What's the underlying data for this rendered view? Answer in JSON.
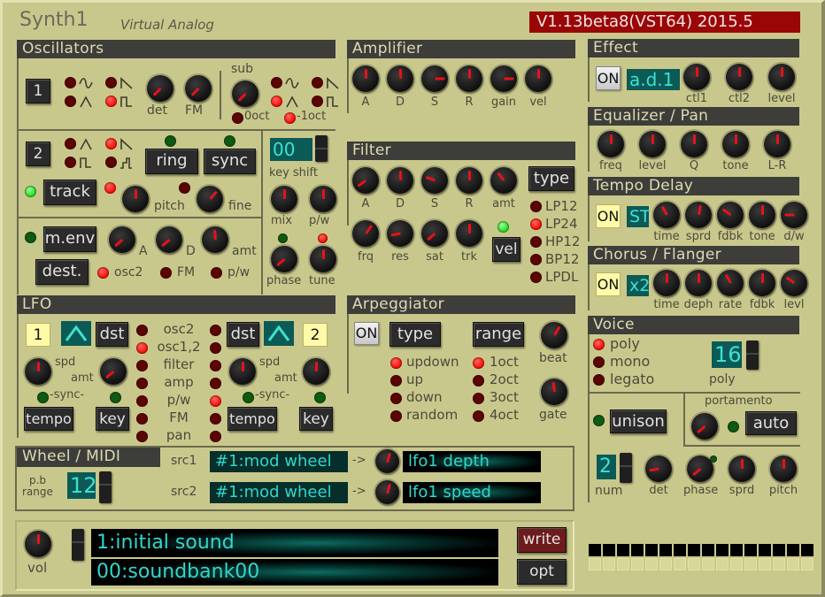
{
  "app": {
    "title": "Synth1",
    "subtitle": "Virtual Analog",
    "version": "V1.13beta8(VST64) 2015.5"
  },
  "oscillators": {
    "header": "Oscillators",
    "osc1_button": "1",
    "osc1_waves": [
      {
        "shape": "sine",
        "on": false
      },
      {
        "shape": "saw",
        "on": false
      },
      {
        "shape": "triangle",
        "on": false
      },
      {
        "shape": "square",
        "on": true
      }
    ],
    "det_label": "det",
    "fm_label": "FM",
    "sub_label": "sub",
    "sub_waves": [
      {
        "shape": "sine",
        "on": false
      },
      {
        "shape": "saw",
        "on": false
      },
      {
        "shape": "triangle",
        "on": true
      },
      {
        "shape": "square",
        "on": false
      }
    ],
    "sub_oct": [
      {
        "label": "0oct",
        "on": false
      },
      {
        "label": "-1oct",
        "on": true
      }
    ],
    "osc2_button": "2",
    "osc2_waves": [
      {
        "shape": "triangle",
        "on": false
      },
      {
        "shape": "saw",
        "on": true
      },
      {
        "shape": "square",
        "on": false
      },
      {
        "shape": "noise-pulse",
        "on": false
      }
    ],
    "ring_label": "ring",
    "sync_label": "sync",
    "track_label": "track",
    "pitch_label": "pitch",
    "fine_label": "fine",
    "keyshift_value": "00",
    "keyshift_label": "key shift",
    "mix_label": "mix",
    "pw_label": "p/w",
    "phase_label": "phase",
    "tune_label": "tune",
    "menv_label": "m.env",
    "a_label": "A",
    "d_label": "D",
    "amt_label": "amt",
    "dest_label": "dest.",
    "dest_options": [
      {
        "label": "osc2",
        "on": true
      },
      {
        "label": "FM",
        "on": false
      },
      {
        "label": "p/w",
        "on": false
      }
    ]
  },
  "amplifier": {
    "header": "Amplifier",
    "knobs": [
      "A",
      "D",
      "S",
      "R",
      "gain",
      "vel"
    ]
  },
  "filter": {
    "header": "Filter",
    "knobs_top": [
      "A",
      "D",
      "S",
      "R",
      "amt"
    ],
    "knobs_bottom": [
      "frq",
      "res",
      "sat",
      "trk"
    ],
    "type_label": "type",
    "vel_label": "vel",
    "types": [
      {
        "label": "LP12",
        "on": false
      },
      {
        "label": "LP24",
        "on": true
      },
      {
        "label": "HP12",
        "on": false
      },
      {
        "label": "BP12",
        "on": false
      },
      {
        "label": "LPDL",
        "on": false
      }
    ]
  },
  "lfo": {
    "header": "LFO",
    "lfo1_num": "1",
    "lfo2_num": "2",
    "dst_label": "dst",
    "spd_label": "spd",
    "amt_label": "amt",
    "sync_label": "-sync-",
    "tempo_label": "tempo",
    "key_label": "key",
    "destinations": [
      "osc2",
      "osc1,2",
      "filter",
      "amp",
      "p/w",
      "FM",
      "pan"
    ],
    "lfo1_dest_on": "osc1,2",
    "lfo2_dest_on": "p/w"
  },
  "arpeggiator": {
    "header": "Arpeggiator",
    "on_label": "ON",
    "type_label": "type",
    "range_label": "range",
    "beat_label": "beat",
    "gate_label": "gate",
    "types": [
      {
        "label": "updown",
        "on": true
      },
      {
        "label": "up",
        "on": false
      },
      {
        "label": "down",
        "on": false
      },
      {
        "label": "random",
        "on": false
      }
    ],
    "ranges": [
      {
        "label": "1oct",
        "on": true
      },
      {
        "label": "2oct",
        "on": false
      },
      {
        "label": "3oct",
        "on": false
      },
      {
        "label": "4oct",
        "on": false
      }
    ]
  },
  "effect": {
    "header": "Effect",
    "on_label": "ON",
    "type": "a.d.1",
    "knobs": [
      "ctl1",
      "ctl2",
      "level"
    ]
  },
  "eq": {
    "header": "Equalizer / Pan",
    "knobs": [
      "freq",
      "level",
      "Q",
      "tone",
      "L-R"
    ]
  },
  "delay": {
    "header": "Tempo Delay",
    "on_label": "ON",
    "mode": "ST",
    "knobs": [
      "time",
      "sprd",
      "fdbk",
      "tone",
      "d/w"
    ]
  },
  "chorus": {
    "header": "Chorus / Flanger",
    "on_label": "ON",
    "mode": "x2",
    "knobs": [
      "time",
      "deph",
      "rate",
      "fdbk",
      "levl"
    ]
  },
  "voice": {
    "header": "Voice",
    "modes": [
      {
        "label": "poly",
        "on": true
      },
      {
        "label": "mono",
        "on": false
      },
      {
        "label": "legato",
        "on": false
      }
    ],
    "poly_value": "16",
    "poly_label": "poly",
    "unison_label": "unison",
    "portamento_label": "portamento",
    "auto_label": "auto",
    "num_value": "2",
    "num_label": "num",
    "knobs": [
      "det",
      "phase",
      "sprd",
      "pitch"
    ]
  },
  "wheel": {
    "header": "Wheel / MIDI",
    "pb_label1": "p.b",
    "pb_label2": "range",
    "pb_value": "12",
    "src1_label": "src1",
    "src1_value": "#1:mod wheel",
    "dest1_value": "lfo1 depth",
    "src2_label": "src2",
    "src2_value": "#1:mod wheel",
    "dest2_value": "lfo1 speed",
    "arrow": "->"
  },
  "patch": {
    "vol_label": "vol",
    "program": "1:initial sound",
    "bank": "00:soundbank00",
    "write_label": "write",
    "opt_label": "opt"
  },
  "keyboard_indicator": {
    "count": 16
  }
}
